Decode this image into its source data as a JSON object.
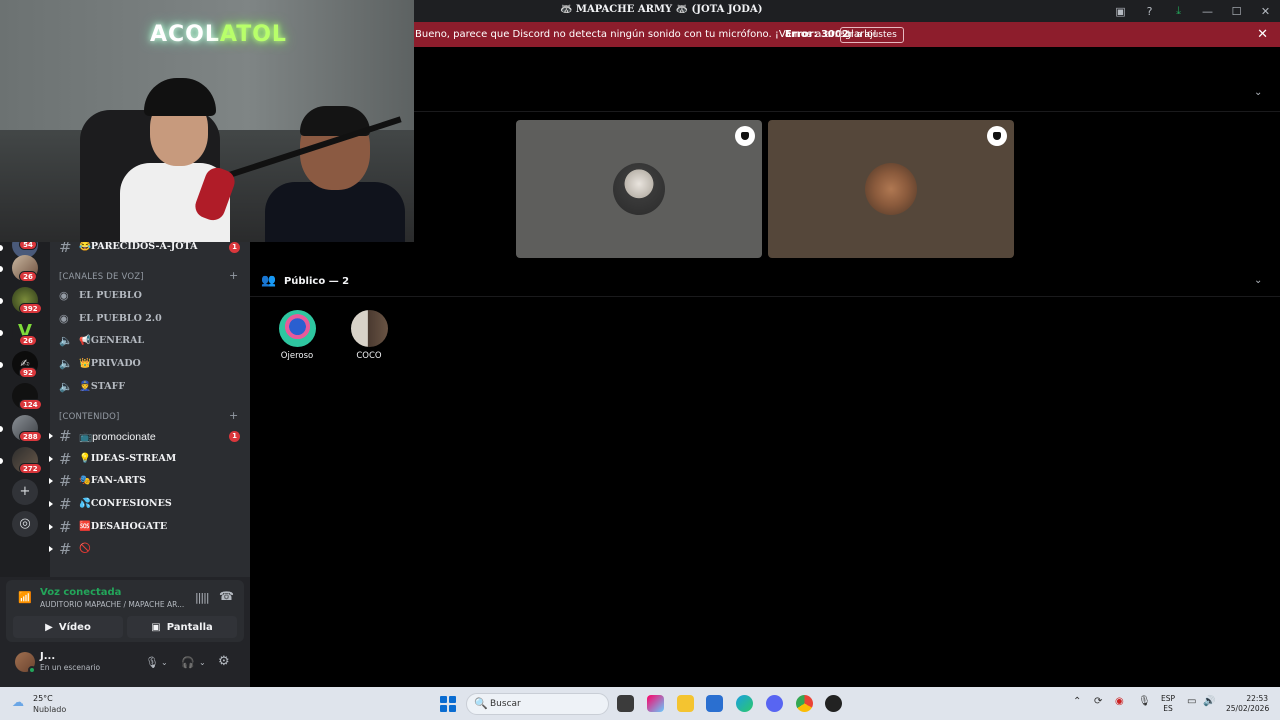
{
  "window": {
    "title": "🦝 MAPACHE ARMY 🦝 (JOTA JODA)",
    "icons": [
      "inbox-icon",
      "help-icon",
      "download-icon",
      "minimize-icon",
      "maximize-icon",
      "close-icon"
    ]
  },
  "webcam": {
    "neon_text_a": "ACOL",
    "neon_text_b": "ATOL"
  },
  "notice": {
    "message": "Bueno, parece que Discord no detecta ningún sonido con tu micrófono. ¡Vamos a arreglarlo!",
    "error": "Error: 3002",
    "button": "Ir a ajustes",
    "close": "✕"
  },
  "servers": [
    {
      "badge": "54"
    },
    {
      "badge": "26"
    },
    {
      "badge": "392"
    },
    {
      "badge": "26"
    },
    {
      "badge": "92"
    },
    {
      "badge": "124"
    },
    {
      "badge": "288"
    },
    {
      "badge": "272"
    }
  ],
  "rail_actions": {
    "add": "+",
    "discover": "◎"
  },
  "channels": {
    "top": {
      "name": "😂PARECIDOS-A-JOTA",
      "unread": "1"
    },
    "voice_category": "[CANALES DE VOZ]",
    "voice": [
      {
        "name": "EL PUEBLO"
      },
      {
        "name": "EL PUEBLO 2.0"
      },
      {
        "name": "📢GENERAL"
      },
      {
        "name": "👑PRIVADO"
      },
      {
        "name": "👮STAFF"
      }
    ],
    "content_category": "[CONTENIDO]",
    "content": [
      {
        "name": "📺promocionate",
        "unread": "1"
      },
      {
        "name": "💡IDEAS-STREAM"
      },
      {
        "name": "🎭FAN-ARTS"
      },
      {
        "name": "💦CONFESIONES"
      },
      {
        "name": "🆘DESAHOGATE"
      },
      {
        "name": "🚫"
      }
    ]
  },
  "voice_panel": {
    "status": "Voz conectada",
    "location": "AUDITORIO MAPACHE / MAPACHE AR...",
    "video_label": "Vídeo",
    "screen_label": "Pantalla",
    "user_name": "J...",
    "user_status": "En un escenario"
  },
  "stage": {
    "audience_label": "Público — 2",
    "members": [
      {
        "name": "Ojeroso"
      },
      {
        "name": "COCO"
      }
    ]
  },
  "taskbar": {
    "temperature": "25°C",
    "condition": "Nublado",
    "search_placeholder": "Buscar",
    "lang_a": "ESP",
    "lang_b": "ES",
    "time": "22:53",
    "date": "25/02/2026"
  },
  "colors": {
    "notice_bg": "#8d1d2c",
    "voice_connected": "#23a55a",
    "badge_red": "#da373c",
    "tile1_bg": "#5e5e5c",
    "tile2_bg": "#55473a"
  }
}
